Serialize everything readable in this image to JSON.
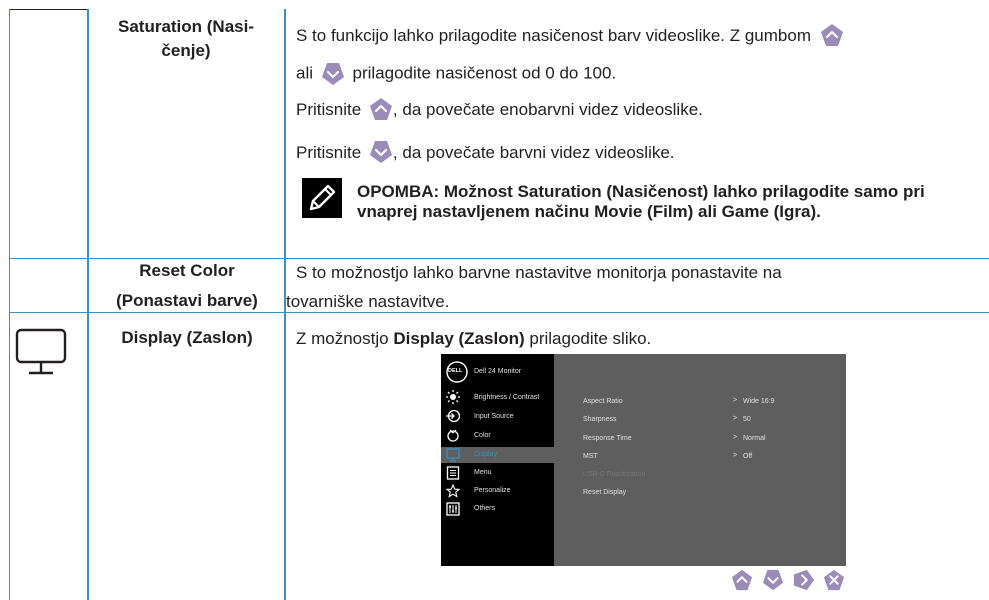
{
  "rows": {
    "saturation": {
      "label": "Saturation (Nasi-\nčenje)",
      "line1_a": "S to funkcijo lahko prilagodite nasičenost barv videoslike. Z gumbom",
      "line2_a": "ali",
      "line2_b": "prilagodite nasičenost od 0 do 100.",
      "line3_a": "Pritisnite",
      "line3_b": ", da povečate enobarvni videz videoslike.",
      "line4_a": "Pritisnite",
      "line4_b": ", da povečate barvni videz videoslike.",
      "note": "OPOMBA: Možnost Saturation (Nasičenost) lahko prilagodite samo pri vnaprej nastavljenem načinu Movie (Film) ali Game (Igra)."
    },
    "reset_color": {
      "label1": "Reset Color",
      "label2": "(Ponastavi barve)",
      "line1": "S to možnostjo lahko barvne nastavitve monitorja ponastavite na",
      "line2": "tovarniške nastavitve."
    },
    "display": {
      "label": "Display (Zaslon)",
      "text_a": "Z možnostjo",
      "text_b": "Display (Zaslon)",
      "text_c": "prilagodite sliko."
    }
  },
  "osd": {
    "brand": "DELL",
    "title": "Dell 24 Monitor",
    "menu": [
      {
        "label": "Brightness / Contrast",
        "icon": "brightness-icon"
      },
      {
        "label": "Input Source",
        "icon": "input-source-icon"
      },
      {
        "label": "Color",
        "icon": "color-icon"
      },
      {
        "label": "Display",
        "icon": "display-icon",
        "active": true
      },
      {
        "label": "Menu",
        "icon": "menu-icon"
      },
      {
        "label": "Personalize",
        "icon": "star-icon"
      },
      {
        "label": "Others",
        "icon": "others-icon"
      }
    ],
    "settings": [
      {
        "label": "Aspect Ratio",
        "value": "Wide 16:9"
      },
      {
        "label": "Sharpness",
        "value": "50"
      },
      {
        "label": "Response Time",
        "value": "Normal"
      },
      {
        "label": "MST",
        "value": "Off"
      },
      {
        "label": "USB-C Prioritization",
        "value": "",
        "disabled": true
      },
      {
        "label": "Reset Display",
        "value": ""
      }
    ],
    "arrow": ">",
    "buttons": [
      "up-button",
      "down-button",
      "right-button",
      "close-button"
    ]
  },
  "colors": {
    "table_line": "#3b8fc4",
    "button": "#9a8bb8",
    "osd_bg": "#000000",
    "osd_panel": "#5e5e5e",
    "osd_active": "#3b8fc4"
  }
}
